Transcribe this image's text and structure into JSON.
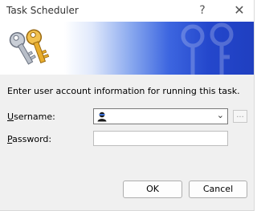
{
  "window": {
    "title": "Task Scheduler",
    "help_glyph": "?",
    "close_glyph": "✕"
  },
  "banner": {
    "icon": "keys-icon"
  },
  "info_text": "Enter user account information for running this task.",
  "username": {
    "label_underlined": "U",
    "label_rest": "sername:",
    "value": ""
  },
  "browse_label": "...",
  "password": {
    "label_underlined": "P",
    "label_rest": "assword:",
    "value": ""
  },
  "buttons": {
    "ok": "OK",
    "cancel": "Cancel"
  },
  "colors": {
    "banner_blue": "#2447cc",
    "window_bg": "#f0f0f0"
  }
}
